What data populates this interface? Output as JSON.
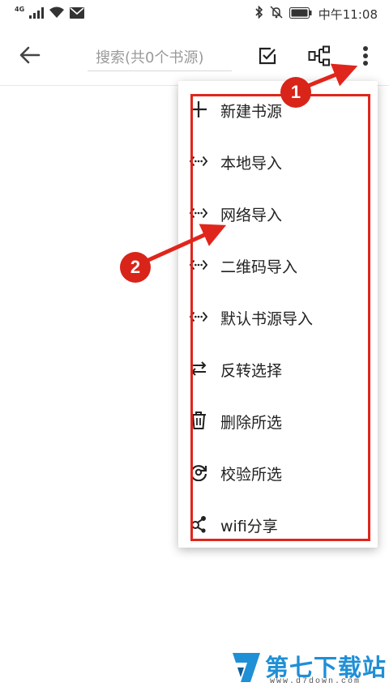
{
  "status_bar": {
    "network": "4G",
    "time": "中午11:08"
  },
  "toolbar": {
    "search_placeholder": "搜索(共0个书源)"
  },
  "menu": {
    "items": [
      {
        "label": "新建书源",
        "icon": "plus-icon"
      },
      {
        "label": "本地导入",
        "icon": "import-icon"
      },
      {
        "label": "网络导入",
        "icon": "import-icon"
      },
      {
        "label": "二维码导入",
        "icon": "import-icon"
      },
      {
        "label": "默认书源导入",
        "icon": "import-icon"
      },
      {
        "label": "反转选择",
        "icon": "swap-icon"
      },
      {
        "label": "删除所选",
        "icon": "trash-icon"
      },
      {
        "label": "校验所选",
        "icon": "check-cycle-icon"
      },
      {
        "label": "wifi分享",
        "icon": "share-icon"
      }
    ]
  },
  "annotations": {
    "badge_1": "1",
    "badge_2": "2",
    "accent_color": "#e0261c"
  },
  "watermark": {
    "title": "第七下载站",
    "url": "www.d7down.com"
  }
}
